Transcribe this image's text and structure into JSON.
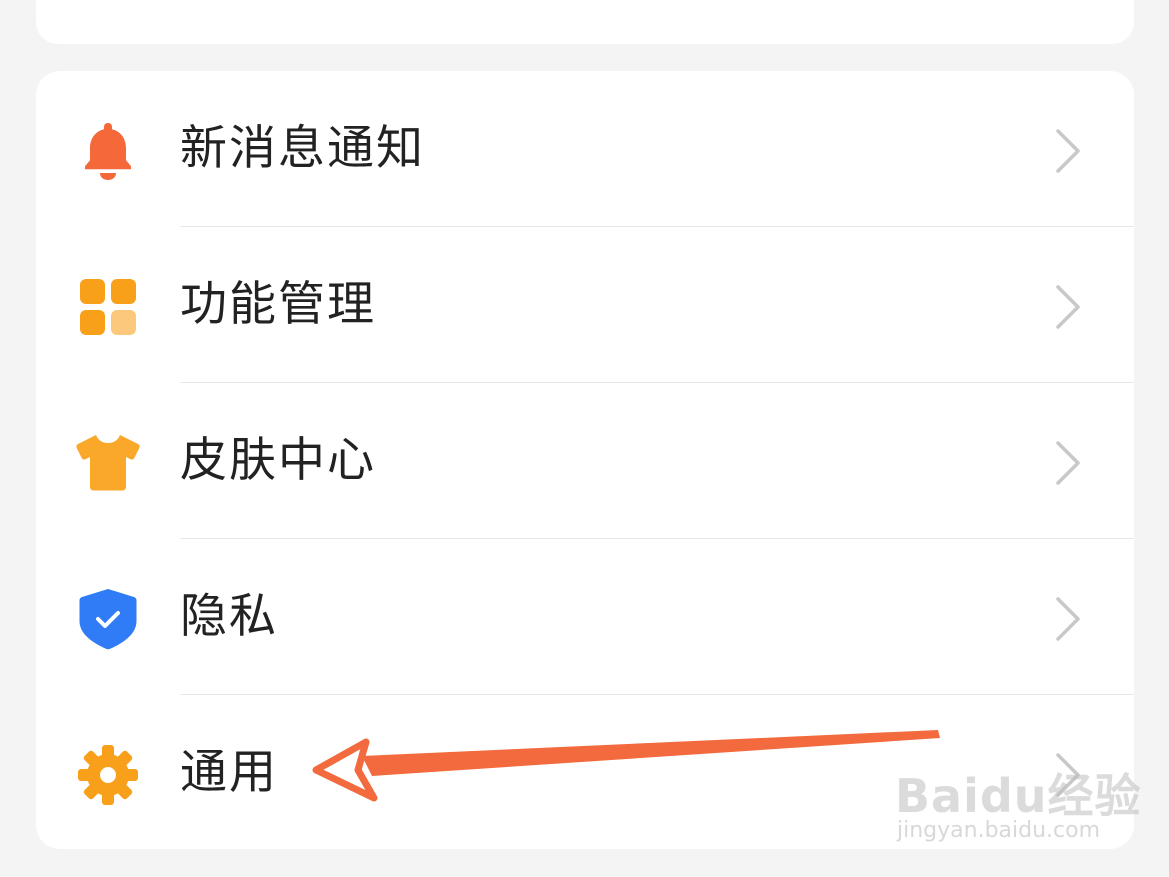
{
  "menu": {
    "items": [
      {
        "label": "新消息通知",
        "icon": "bell-icon",
        "icon_color": "#f4683a"
      },
      {
        "label": "功能管理",
        "icon": "grid-icon",
        "icon_color": "#f9a01b"
      },
      {
        "label": "皮肤中心",
        "icon": "tshirt-icon",
        "icon_color": "#f9a82a"
      },
      {
        "label": "隐私",
        "icon": "shield-check-icon",
        "icon_color": "#2f7cf6"
      },
      {
        "label": "通用",
        "icon": "gear-icon",
        "icon_color": "#f9a01b"
      }
    ]
  },
  "annotation": {
    "arrow_color": "#f26a3d",
    "points_to": "通用"
  },
  "watermark": {
    "logo": "Baidu经验",
    "url": "jingyan.baidu.com"
  }
}
